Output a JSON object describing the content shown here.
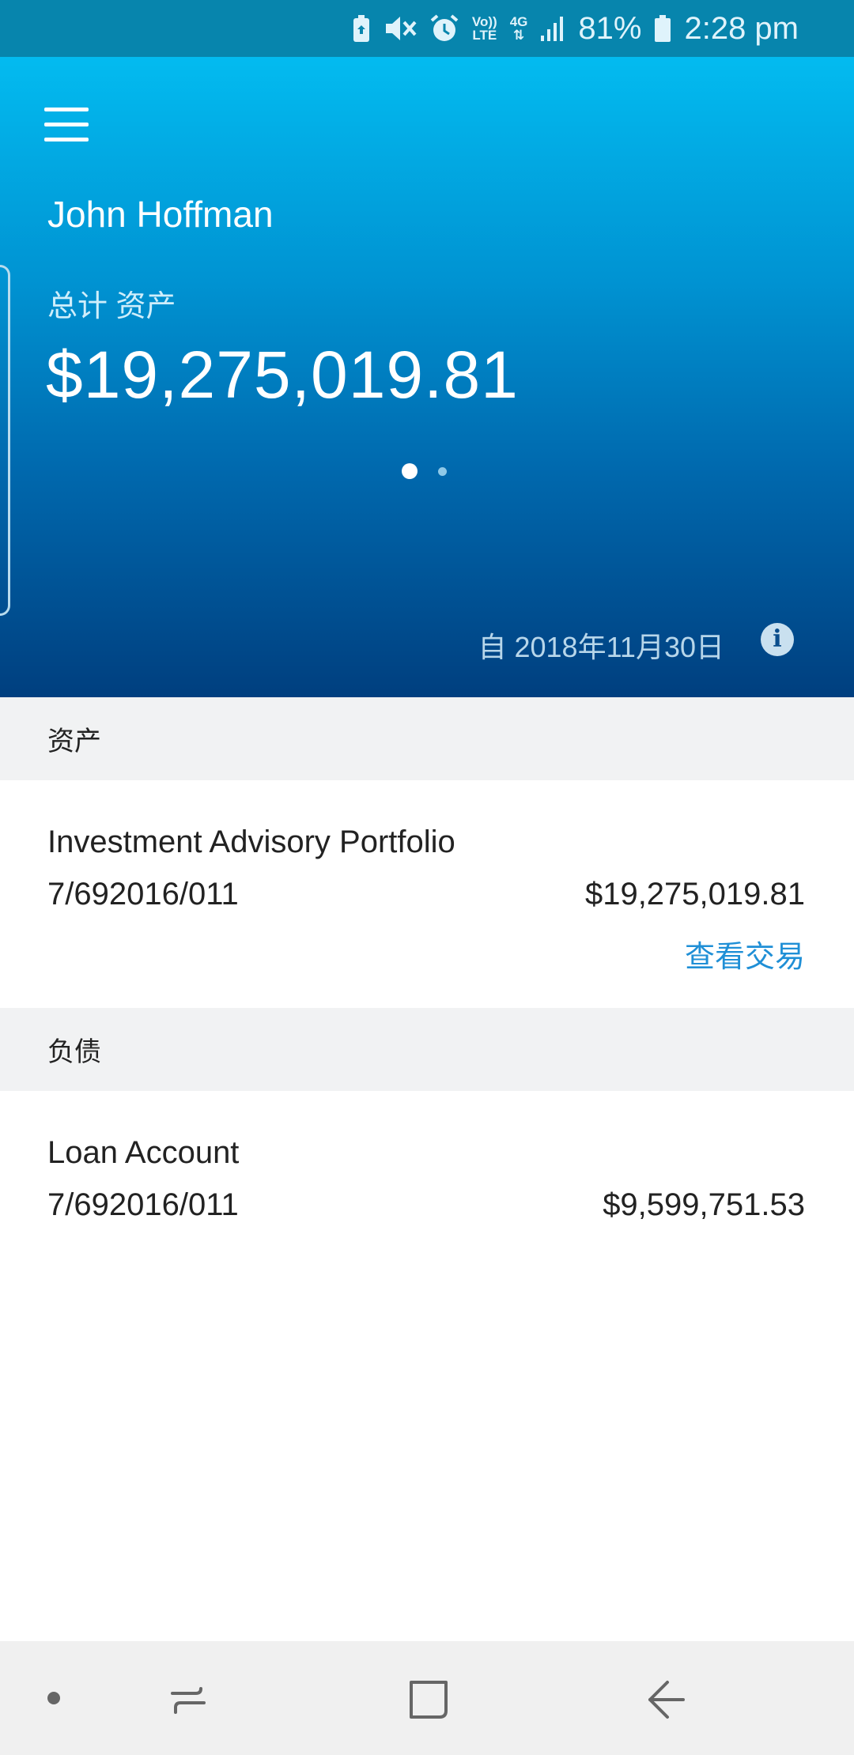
{
  "status_bar": {
    "volte_top": "Vo))",
    "volte_bottom": "LTE",
    "network": "4G",
    "battery": "81%",
    "time": "2:28 pm"
  },
  "header": {
    "user_name": "John Hoffman",
    "total_label": "总计 资产",
    "total_value": "$19,275,019.81",
    "as_of": "自 2018年11月30日",
    "info_icon": "info-icon",
    "pager": {
      "pages": 2,
      "active": 1
    }
  },
  "sections": {
    "assets": {
      "title": "资产",
      "account": {
        "name": "Investment Advisory Portfolio",
        "number": "7/692016/011",
        "amount": "$19,275,019.81",
        "link": "查看交易"
      }
    },
    "liabilities": {
      "title": "负债",
      "account": {
        "name": "Loan Account",
        "number": "7/692016/011",
        "amount": "$9,599,751.53"
      }
    }
  },
  "colors": {
    "status_bar": "#0785ad",
    "hero_top": "#03bbf0",
    "hero_bottom": "#003f7f",
    "link": "#1f8fd6",
    "section_header_bg": "#f1f2f3"
  }
}
